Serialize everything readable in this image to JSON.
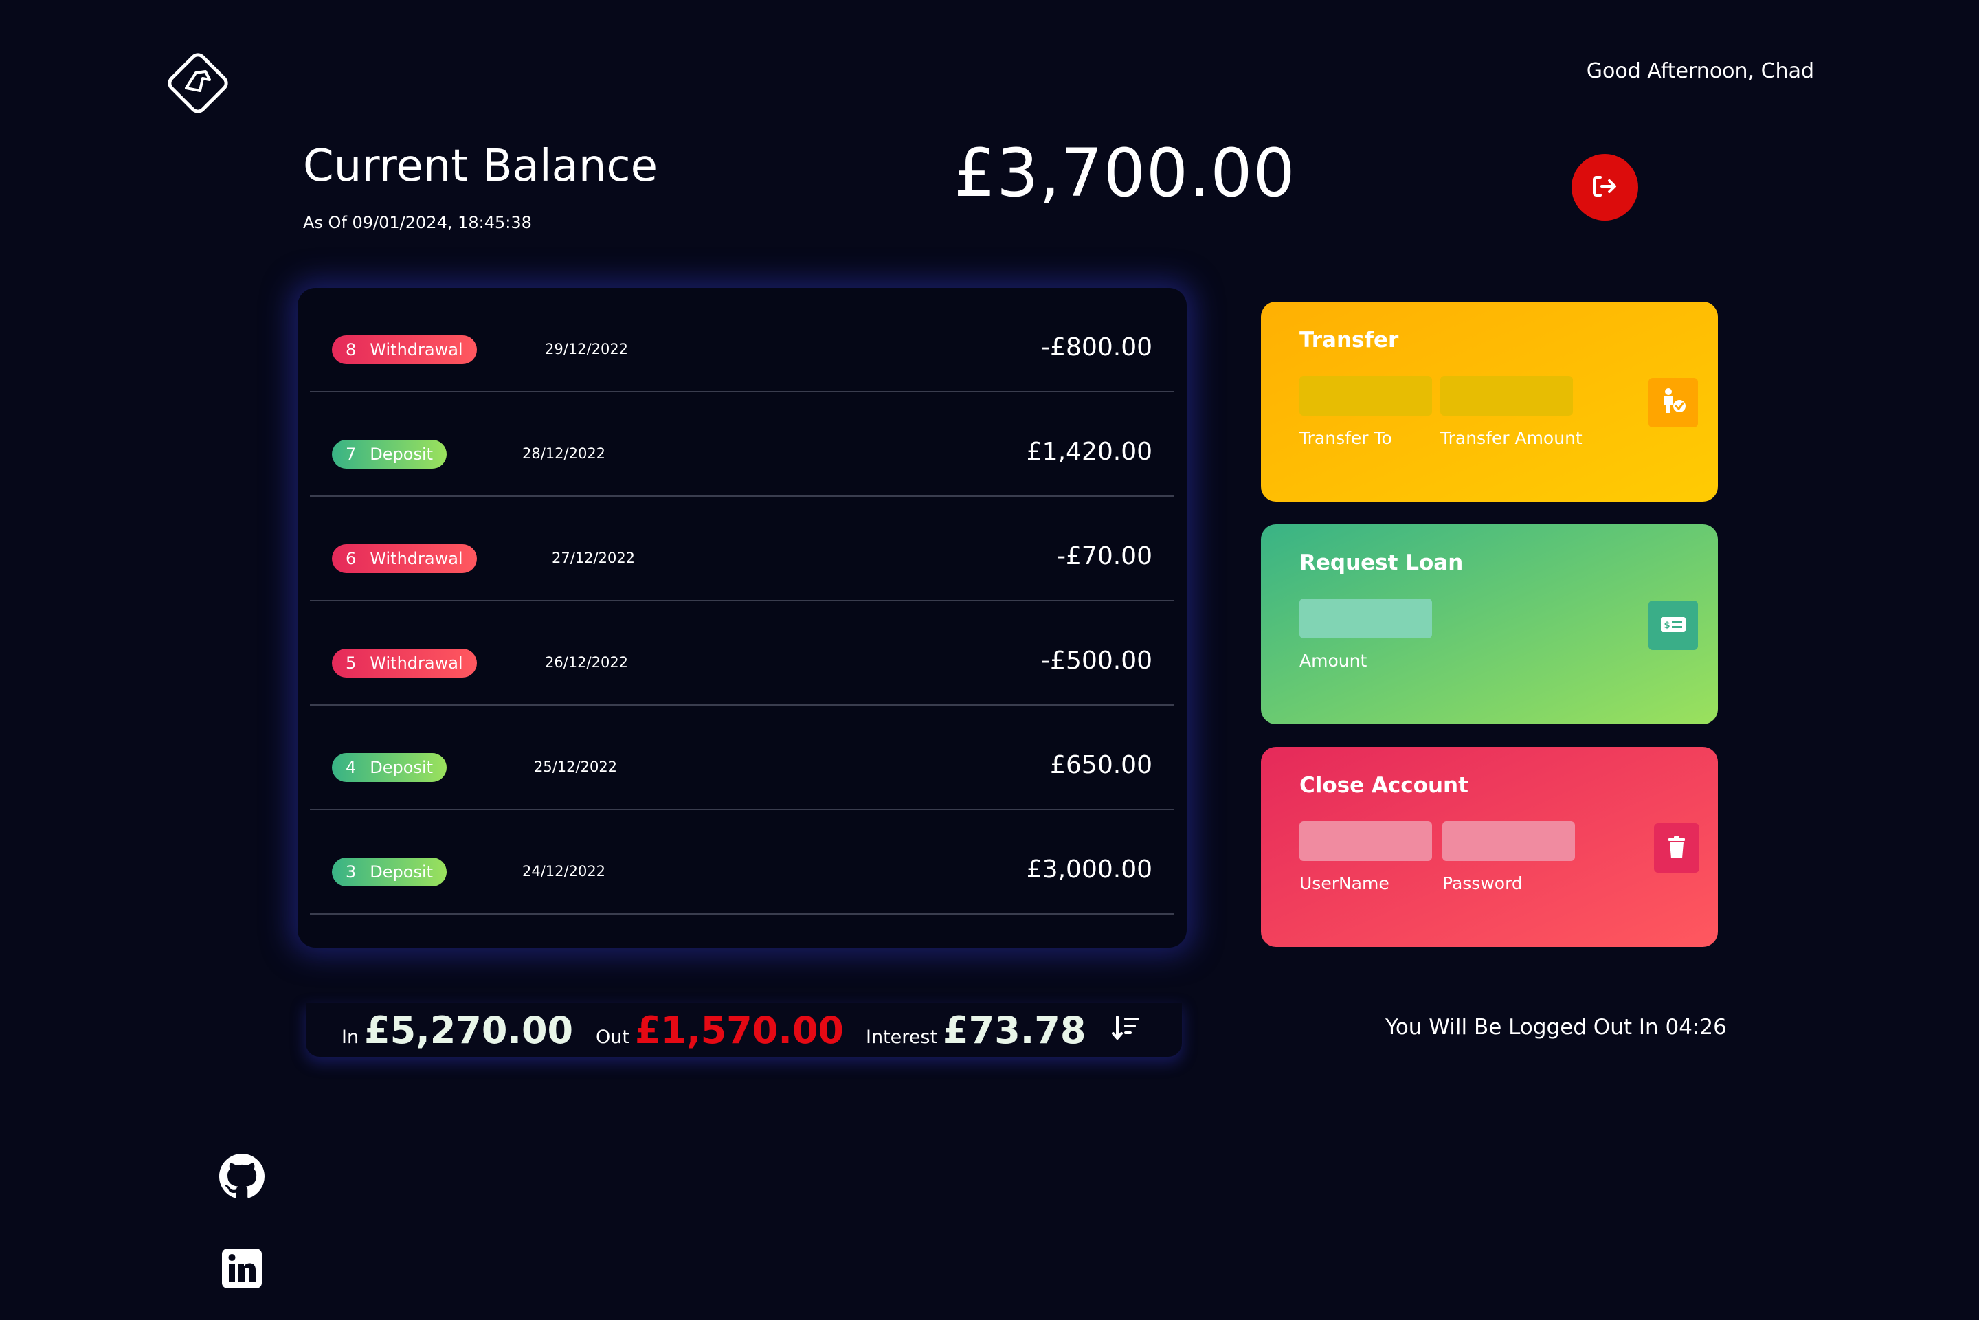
{
  "header": {
    "greeting": "Good Afternoon, Chad"
  },
  "balance": {
    "title": "Current Balance",
    "date": "As Of 09/01/2024, 18:45:38",
    "amount": "£3,700.00"
  },
  "movements": [
    {
      "index": "8",
      "type": "Withdrawal",
      "kind": "withdrawal",
      "date": "29/12/2022",
      "value": "-£800.00"
    },
    {
      "index": "7",
      "type": "Deposit",
      "kind": "deposit",
      "date": "28/12/2022",
      "value": "£1,420.00"
    },
    {
      "index": "6",
      "type": "Withdrawal",
      "kind": "withdrawal",
      "date": "27/12/2022",
      "value": "-£70.00"
    },
    {
      "index": "5",
      "type": "Withdrawal",
      "kind": "withdrawal",
      "date": "26/12/2022",
      "value": "-£500.00"
    },
    {
      "index": "4",
      "type": "Deposit",
      "kind": "deposit",
      "date": "25/12/2022",
      "value": "£650.00"
    },
    {
      "index": "3",
      "type": "Deposit",
      "kind": "deposit",
      "date": "24/12/2022",
      "value": "£3,000.00"
    }
  ],
  "summary": {
    "in_label": "In",
    "in_value": "£5,270.00",
    "out_label": "Out",
    "out_value": "£1,570.00",
    "interest_label": "Interest",
    "interest_value": "£73.78"
  },
  "operations": {
    "transfer": {
      "title": "Transfer",
      "to_label": "Transfer To",
      "amount_label": "Transfer Amount"
    },
    "loan": {
      "title": "Request Loan",
      "amount_label": "Amount"
    },
    "close": {
      "title": "Close Account",
      "username_label": "UserName",
      "password_label": "Password"
    }
  },
  "timer": {
    "text": "You Will Be Logged Out In 04:26"
  },
  "icons": {
    "logo": "logo-icon",
    "logout": "logout-icon",
    "sort": "sort-icon",
    "transfer": "person-check-icon",
    "loan": "money-bill-icon",
    "close": "trash-icon",
    "github": "github-icon",
    "linkedin": "linkedin-icon"
  },
  "colors": {
    "background": "#060819",
    "withdrawal": "#e52a5a",
    "deposit": "#39b385",
    "logout": "#dc0c0c",
    "out": "#e50914"
  }
}
